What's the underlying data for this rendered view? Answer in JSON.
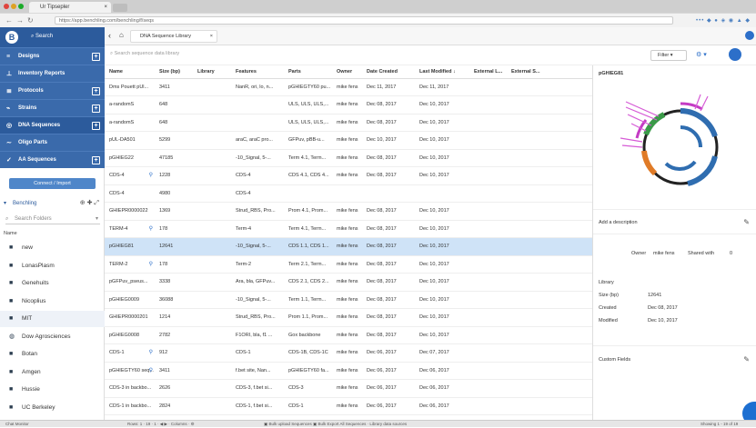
{
  "browser": {
    "tab_title": "Ur Tipsepler",
    "url": "https://app.benchling.com/benchling/f/seqs",
    "extensions": "••• ◆ ● ◈ ◉ ▲ ◆"
  },
  "sidebar": {
    "logo": "B",
    "search_label": "Search",
    "nav": [
      {
        "icon": "≡",
        "label": "Designs",
        "has_add": true
      },
      {
        "icon": "⊥",
        "label": "Inventory Reports",
        "has_add": false
      },
      {
        "icon": "≣",
        "label": "Protocols",
        "has_add": true
      },
      {
        "icon": "⌁",
        "label": "Strains",
        "has_add": true
      },
      {
        "icon": "◎",
        "label": "DNA Sequences",
        "has_add": true,
        "active": true
      },
      {
        "icon": "∼",
        "label": "Oligo Parts",
        "has_add": false
      },
      {
        "icon": "✓",
        "label": "AA Sequences",
        "has_add": true
      }
    ],
    "connect_label": "Connect / Import",
    "folder_header": "Benchling",
    "folder_actions": "⊕ ✚ ⤢",
    "folder_search_placeholder": "Search Folders",
    "name_label": "Name",
    "folders": [
      {
        "label": "new",
        "selected": false
      },
      {
        "label": "LonasPlasm",
        "selected": false
      },
      {
        "label": "Genehuits",
        "selected": false
      },
      {
        "label": "Nicoplius",
        "selected": false
      },
      {
        "label": "MIT",
        "selected": true
      },
      {
        "label": "Dow Agrosciences",
        "selected": false
      },
      {
        "label": "Botan",
        "selected": false
      },
      {
        "label": "Amgen",
        "selected": false
      },
      {
        "label": "Hussie",
        "selected": false
      },
      {
        "label": "UC Berkeley",
        "selected": false
      }
    ]
  },
  "page": {
    "tab_label": "DNA Sequence Library",
    "search_placeholder": "Search sequence data library",
    "filter_label": "Filter ▾",
    "view_label": "⚙ ▾",
    "columns": [
      "Name",
      "Size (bp)",
      "Library",
      "Features",
      "Parts",
      "Owner",
      "Date Created",
      "Last Modified ↓",
      "External L...",
      "External S..."
    ],
    "rows": [
      {
        "name": "Dms Pouett pUl...",
        "link": false,
        "size": "3411",
        "features": "NanR, ori, lo, n...",
        "parts": "pGHIEGTY60 pu...",
        "owner": "mike fens",
        "created": "Dec 11, 2017",
        "modified": "Dec 11, 2017",
        "selected": false
      },
      {
        "name": "a-randomS",
        "link": false,
        "size": "648",
        "features": "",
        "parts": "ULS, ULS, ULS,...",
        "owner": "mike fens",
        "created": "Dec 08, 2017",
        "modified": "Dec 10, 2017",
        "selected": false
      },
      {
        "name": "a-randomS",
        "link": false,
        "size": "648",
        "features": "",
        "parts": "ULS, ULS, ULS,...",
        "owner": "mike fens",
        "created": "Dec 08, 2017",
        "modified": "Dec 10, 2017",
        "selected": false
      },
      {
        "name": "pUL-DA501",
        "link": false,
        "size": "5299",
        "features": "araC, araC pro...",
        "parts": "GFPuv, pBB-u...",
        "owner": "mike fens",
        "created": "Dec 10, 2017",
        "modified": "Dec 10, 2017",
        "selected": false
      },
      {
        "name": "pGHIEG22",
        "link": false,
        "size": "47185",
        "features": "-10_Signal, 5-...",
        "parts": "Term 4.1, Term...",
        "owner": "mike fens",
        "created": "Dec 08, 2017",
        "modified": "Dec 10, 2017",
        "selected": false
      },
      {
        "name": "CDS-4",
        "link": true,
        "size": "1228",
        "features": "CDS-4",
        "parts": "CDS 4.1, CDS 4...",
        "owner": "mike fens",
        "created": "Dec 08, 2017",
        "modified": "Dec 10, 2017",
        "selected": false
      },
      {
        "name": "CDS-4",
        "link": false,
        "size": "4980",
        "features": "CDS-4",
        "parts": "",
        "owner": "",
        "created": "",
        "modified": "",
        "selected": false
      },
      {
        "name": "GHIEPR0000022",
        "link": false,
        "size": "1369",
        "features": "Strud_RBS, Pro...",
        "parts": "Prom 4.1, Prom...",
        "owner": "mike fens",
        "created": "Dec 08, 2017",
        "modified": "Dec 10, 2017",
        "selected": false
      },
      {
        "name": "TERM-4",
        "link": true,
        "size": "178",
        "features": "Term-4",
        "parts": "Term 4.1, Term...",
        "owner": "mike fens",
        "created": "Dec 08, 2017",
        "modified": "Dec 10, 2017",
        "selected": false
      },
      {
        "name": "pGHIEG81",
        "link": false,
        "size": "12641",
        "features": "-10_Signal, 5-...",
        "parts": "CDS 1.1, CDS 1...",
        "owner": "mike fens",
        "created": "Dec 08, 2017",
        "modified": "Dec 10, 2017",
        "selected": true
      },
      {
        "name": "TERM-2",
        "link": true,
        "size": "178",
        "features": "Term-2",
        "parts": "Term 2.1, Term...",
        "owner": "mike fens",
        "created": "Dec 08, 2017",
        "modified": "Dec 10, 2017",
        "selected": false
      },
      {
        "name": "pGFPuv_pseus...",
        "link": false,
        "size": "3338",
        "features": "Ara, bla, GFPuv...",
        "parts": "CDS 2.1, CDS 2...",
        "owner": "mike fens",
        "created": "Dec 08, 2017",
        "modified": "Dec 10, 2017",
        "selected": false
      },
      {
        "name": "pGHIEG0009",
        "link": false,
        "size": "36088",
        "features": "-10_Signal, 5-...",
        "parts": "Term 1.1, Term...",
        "owner": "mike fens",
        "created": "Dec 08, 2017",
        "modified": "Dec 10, 2017",
        "selected": false
      },
      {
        "name": "GHIEPR0000201",
        "link": false,
        "size": "1214",
        "features": "Strud_RBS, Pro...",
        "parts": "Prom 1.1, Prom...",
        "owner": "mike fens",
        "created": "Dec 08, 2017",
        "modified": "Dec 10, 2017",
        "selected": false
      },
      {
        "name": "pGHIEG0008",
        "link": false,
        "size": "2782",
        "features": "F1ORI, bla, f1 ...",
        "parts": "Gox backbone",
        "owner": "mike fens",
        "created": "Dec 08, 2017",
        "modified": "Dec 10, 2017",
        "selected": false
      },
      {
        "name": "CDS-1",
        "link": true,
        "size": "912",
        "features": "CDS-1",
        "parts": "CDS-1B, CDS-1C",
        "owner": "mike fens",
        "created": "Dec 06, 2017",
        "modified": "Dec 07, 2017",
        "selected": false
      },
      {
        "name": "pGHIEGTY60 seq...",
        "link": true,
        "size": "3411",
        "features": "f.bet site, Nan...",
        "parts": "pGHIEGTY60 fa...",
        "owner": "mike fens",
        "created": "Dec 06, 2017",
        "modified": "Dec 06, 2017",
        "selected": false
      },
      {
        "name": "CDS-3 in backbo...",
        "link": false,
        "size": "2626",
        "features": "CDS-3, f.bet si...",
        "parts": "CDS-3",
        "owner": "mike fens",
        "created": "Dec 06, 2017",
        "modified": "Dec 06, 2017",
        "selected": false
      },
      {
        "name": "CDS-1 in backbo...",
        "link": false,
        "size": "2824",
        "features": "CDS-1, f.bet si...",
        "parts": "CDS-1",
        "owner": "mike fens",
        "created": "Dec 06, 2017",
        "modified": "Dec 06, 2017",
        "selected": false
      }
    ]
  },
  "panel": {
    "title": "pGHIEG81",
    "add_description": "Add a description",
    "owner_label": "Owner",
    "owner_value": "mike fens",
    "shared_label": "Shared with",
    "shared_count": "0",
    "library_label": "Library",
    "size_label": "Size (bp)",
    "size_value": "12641",
    "created_label": "Created",
    "created_value": "Dec 08, 2017",
    "modified_label": "Modified",
    "modified_value": "Dec 10, 2017",
    "custom_fields_label": "Custom Fields"
  },
  "status": {
    "left": "Chat Monitor",
    "center": "Rows: 1 · 19 · 1 · ◀ ▶ · Columns · ⚙",
    "links": "▣ Bulk upload Sequences  ▣ Bulk Export All Sequences  ·  Library data sources",
    "right": "Showing 1 - 19 of 19"
  },
  "colors": {
    "brand": "#2c5b9c",
    "nav": "#3a6aab",
    "accent": "#2c6fc9",
    "selected_row": "#cfe3f7"
  }
}
